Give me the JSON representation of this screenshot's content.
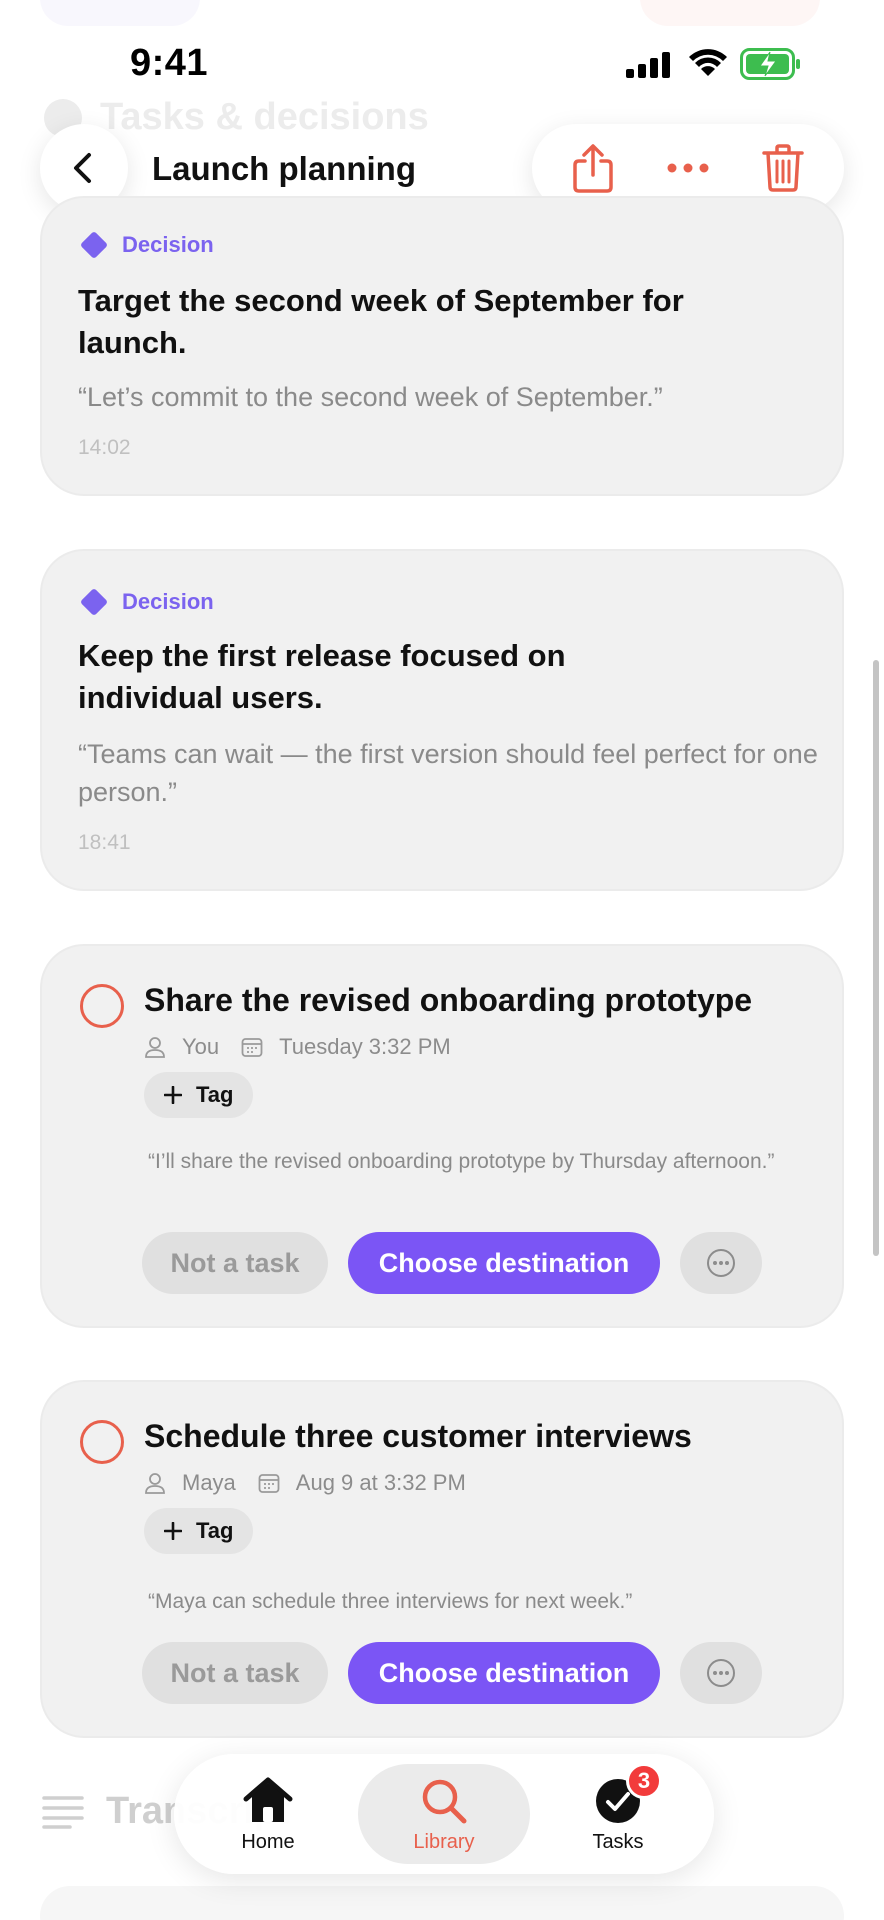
{
  "status_bar": {
    "time": "9:41"
  },
  "header": {
    "title": "Launch planning"
  },
  "background": {
    "section_title": "Tasks & decisions",
    "transcript_title": "Transcript"
  },
  "decisions": [
    {
      "tag": "Decision",
      "title": "Target the second week of September for launch.",
      "quote": "“Let’s commit to the second week of September.”",
      "time": "14:02"
    },
    {
      "tag": "Decision",
      "title": "Keep the first release focused on individual users.",
      "quote": "“Teams can wait — the first version should feel perfect for one person.”",
      "time": "18:41"
    }
  ],
  "tasks": [
    {
      "title": "Share the revised onboarding prototype",
      "assignee": "You",
      "due": "Tuesday 3:32 PM",
      "tag_label": "Tag",
      "quote": "“I’ll share the revised onboarding prototype by Thursday afternoon.”",
      "not_task_label": "Not a task",
      "choose_label": "Choose destination"
    },
    {
      "title": "Schedule three customer interviews",
      "assignee": "Maya",
      "due": "Aug 9 at 3:32 PM",
      "tag_label": "Tag",
      "quote": "“Maya can schedule three interviews for next week.”",
      "not_task_label": "Not a task",
      "choose_label": "Choose destination"
    }
  ],
  "tab_bar": {
    "tabs": [
      {
        "label": "Home",
        "icon": "house-icon"
      },
      {
        "label": "Library",
        "icon": "search-icon",
        "active": true
      },
      {
        "label": "Tasks",
        "icon": "checkmark-circle-icon",
        "badge": "3"
      }
    ]
  },
  "colors": {
    "accent": "#7b55f5",
    "danger": "#e8604c",
    "decision": "#7b63ef",
    "badge": "#f23b3b"
  }
}
